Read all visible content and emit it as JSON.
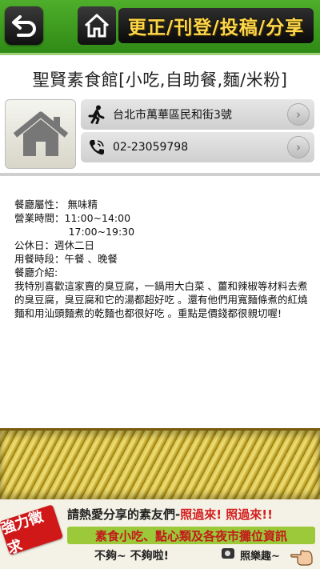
{
  "header": {
    "back_icon": "back-arrow-icon",
    "home_icon": "home-icon",
    "title": "更正/刊登/投稿/分享"
  },
  "shop": {
    "name": "聖賢素食館[小吃,自助餐,麵/米粉]",
    "image_icon": "home-icon",
    "address": "台北市萬華區民和街3號",
    "address_icon": "walking-person-icon",
    "phone": "02-23059798",
    "phone_icon": "phone-icon",
    "arrow_glyph": "›"
  },
  "details": {
    "lines": [
      "餐廳屬性： 無味精",
      "營業時間：11:00~14:00",
      "                 17:00~19:30",
      "公休日：週休二日",
      "用餐時段：午餐 、晚餐",
      "餐廳介紹:",
      "我特別喜歡這家賣的臭豆腐，一鍋用大白菜 、薑和辣椒等材料去煮的臭豆腐，臭豆腐和它的湯都超好吃 。還有他們用寬麵條煮的紅燒麵和用汕頭麵煮的乾麵也都很好吃 。重點是價錢都很親切喔!"
    ]
  },
  "ad": {
    "badge": "強力徵求",
    "line1_prefix": "請熱愛分享的素友們-",
    "line1_red": "照過來! 照過來!!",
    "strip": "素食小吃、點心類及各夜市攤位資訊",
    "line3": "不夠~ 不夠啦!",
    "line3_right": "照樂趣~"
  },
  "colors": {
    "header_green": "#3a9a1f",
    "title_yellow": "#ffd84a",
    "ad_red": "#d01818",
    "strip_green": "#9bc93a"
  }
}
